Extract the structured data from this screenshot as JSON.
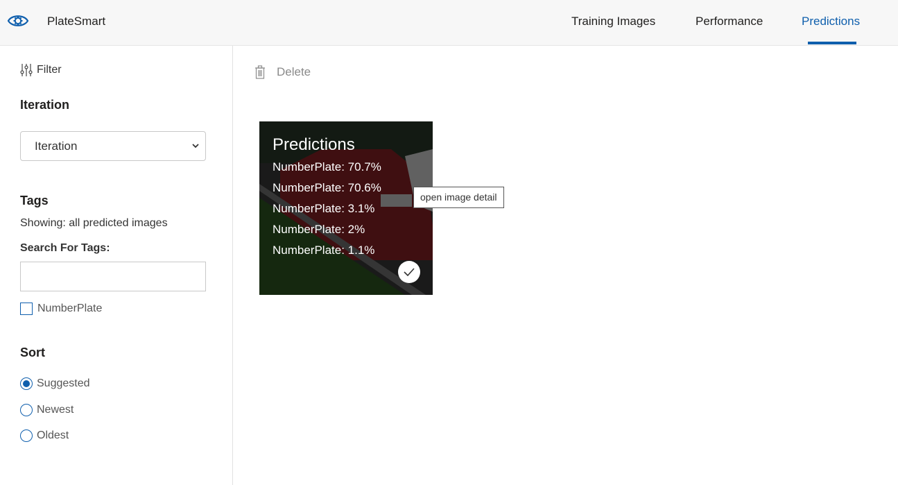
{
  "header": {
    "app_title": "PlateSmart",
    "logo_icon": "eye-gear-icon",
    "tabs": [
      {
        "label": "Training Images",
        "active": false
      },
      {
        "label": "Performance",
        "active": false
      },
      {
        "label": "Predictions",
        "active": true
      }
    ],
    "accent_color": "#0f5fad"
  },
  "sidebar": {
    "filter_label": "Filter",
    "filter_icon": "sliders-icon",
    "iteration": {
      "title": "Iteration",
      "selected": "Iteration"
    },
    "tags": {
      "title": "Tags",
      "showing_text": "Showing: all predicted images",
      "search_label": "Search For Tags:",
      "search_value": "",
      "search_placeholder": "",
      "options": [
        {
          "label": "NumberPlate",
          "checked": false
        }
      ]
    },
    "sort": {
      "title": "Sort",
      "options": [
        {
          "label": "Suggested",
          "selected": true
        },
        {
          "label": "Newest",
          "selected": false
        },
        {
          "label": "Oldest",
          "selected": false
        }
      ]
    }
  },
  "toolbar": {
    "delete_label": "Delete",
    "delete_icon": "trash-icon"
  },
  "images": [
    {
      "title": "Predictions",
      "predictions": [
        "NumberPlate: 70.7%",
        "NumberPlate: 70.6%",
        "NumberPlate: 3.1%",
        "NumberPlate: 2%",
        "NumberPlate: 1.1%"
      ],
      "selected_icon": "checkmark-icon"
    }
  ],
  "tooltip": "open image detail"
}
